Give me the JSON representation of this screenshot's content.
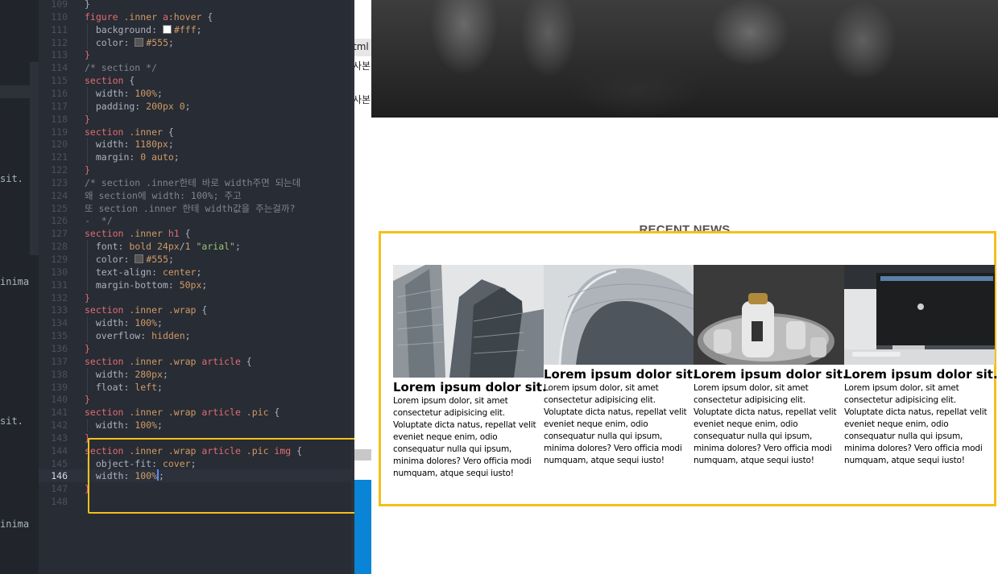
{
  "left_panel": {
    "fragments": [
      "sit.",
      "inima",
      "sit.",
      "inima"
    ]
  },
  "editor": {
    "lines": [
      {
        "n": "109",
        "t": [
          [
            "pun",
            "}"
          ]
        ]
      },
      {
        "n": "110",
        "t": [
          [
            "sel",
            "figure "
          ],
          [
            "cls",
            ".inner "
          ],
          [
            "sel",
            "a"
          ],
          [
            "kw",
            ":hover"
          ],
          [
            "pun",
            " {"
          ]
        ]
      },
      {
        "n": "111",
        "g": 1,
        "t": [
          [
            "prop",
            "  background: "
          ],
          [
            "sw",
            "#ffffff"
          ],
          [
            "num",
            "#fff"
          ],
          [
            "pun",
            ";"
          ]
        ]
      },
      {
        "n": "112",
        "g": 1,
        "t": [
          [
            "prop",
            "  color: "
          ],
          [
            "sw",
            "#555555"
          ],
          [
            "num",
            "#555"
          ],
          [
            "pun",
            ";"
          ]
        ]
      },
      {
        "n": "113",
        "t": [
          [
            "sel",
            "}"
          ]
        ]
      },
      {
        "n": "114",
        "t": [
          [
            "com",
            "/* section */"
          ]
        ]
      },
      {
        "n": "115",
        "t": [
          [
            "sel",
            "section"
          ],
          [
            "pun",
            " {"
          ]
        ]
      },
      {
        "n": "116",
        "g": 1,
        "t": [
          [
            "prop",
            "  width: "
          ],
          [
            "num",
            "100%"
          ],
          [
            "pun",
            ";"
          ]
        ]
      },
      {
        "n": "117",
        "g": 1,
        "t": [
          [
            "prop",
            "  padding: "
          ],
          [
            "num",
            "200px 0"
          ],
          [
            "pun",
            ";"
          ]
        ]
      },
      {
        "n": "118",
        "t": [
          [
            "sel",
            "}"
          ]
        ]
      },
      {
        "n": "119",
        "t": [
          [
            "sel",
            "section "
          ],
          [
            "cls",
            ".inner"
          ],
          [
            "pun",
            " {"
          ]
        ]
      },
      {
        "n": "120",
        "g": 1,
        "t": [
          [
            "prop",
            "  width: "
          ],
          [
            "num",
            "1180px"
          ],
          [
            "pun",
            ";"
          ]
        ]
      },
      {
        "n": "121",
        "g": 1,
        "t": [
          [
            "prop",
            "  margin: "
          ],
          [
            "num",
            "0 auto"
          ],
          [
            "pun",
            ";"
          ]
        ]
      },
      {
        "n": "122",
        "t": [
          [
            "sel",
            "}"
          ]
        ]
      },
      {
        "n": "123",
        "t": [
          [
            "com",
            "/* section .inner한테 바로 width주면 되는데"
          ]
        ]
      },
      {
        "n": "124",
        "t": [
          [
            "com",
            "왜 section에 width: 100%; 주고"
          ]
        ]
      },
      {
        "n": "125",
        "t": [
          [
            "com",
            "또 section .inner 한테 width값을 주는걸까?"
          ]
        ]
      },
      {
        "n": "126",
        "t": [
          [
            "com",
            "-  */"
          ]
        ]
      },
      {
        "n": "127",
        "t": [
          [
            "sel",
            "section "
          ],
          [
            "cls",
            ".inner "
          ],
          [
            "sel",
            "h1"
          ],
          [
            "pun",
            " {"
          ]
        ]
      },
      {
        "n": "128",
        "g": 1,
        "t": [
          [
            "prop",
            "  font: "
          ],
          [
            "num",
            "bold 24px"
          ],
          [
            "pun",
            "/"
          ],
          [
            "num",
            "1 "
          ],
          [
            "str",
            "\"arial\""
          ],
          [
            "pun",
            ";"
          ]
        ]
      },
      {
        "n": "129",
        "g": 1,
        "t": [
          [
            "prop",
            "  color: "
          ],
          [
            "sw",
            "#555555"
          ],
          [
            "num",
            "#555"
          ],
          [
            "pun",
            ";"
          ]
        ]
      },
      {
        "n": "130",
        "g": 1,
        "t": [
          [
            "prop",
            "  text-align: "
          ],
          [
            "num",
            "center"
          ],
          [
            "pun",
            ";"
          ]
        ]
      },
      {
        "n": "131",
        "g": 1,
        "t": [
          [
            "prop",
            "  margin-bottom: "
          ],
          [
            "num",
            "50px"
          ],
          [
            "pun",
            ";"
          ]
        ]
      },
      {
        "n": "132",
        "t": [
          [
            "sel",
            "}"
          ]
        ]
      },
      {
        "n": "133",
        "t": [
          [
            "sel",
            "section "
          ],
          [
            "cls",
            ".inner .wrap"
          ],
          [
            "pun",
            " {"
          ]
        ]
      },
      {
        "n": "134",
        "g": 1,
        "t": [
          [
            "prop",
            "  width: "
          ],
          [
            "num",
            "100%"
          ],
          [
            "pun",
            ";"
          ]
        ]
      },
      {
        "n": "135",
        "g": 1,
        "t": [
          [
            "prop",
            "  overflow: "
          ],
          [
            "num",
            "hidden"
          ],
          [
            "pun",
            ";"
          ]
        ]
      },
      {
        "n": "136",
        "t": [
          [
            "sel",
            "}"
          ]
        ]
      },
      {
        "n": "137",
        "t": [
          [
            "sel",
            "section "
          ],
          [
            "cls",
            ".inner .wrap "
          ],
          [
            "sel",
            "article"
          ],
          [
            "pun",
            " {"
          ]
        ]
      },
      {
        "n": "138",
        "g": 1,
        "t": [
          [
            "prop",
            "  width: "
          ],
          [
            "num",
            "280px"
          ],
          [
            "pun",
            ";"
          ]
        ]
      },
      {
        "n": "139",
        "g": 1,
        "t": [
          [
            "prop",
            "  float: "
          ],
          [
            "num",
            "left"
          ],
          [
            "pun",
            ";"
          ]
        ]
      },
      {
        "n": "140",
        "t": [
          [
            "sel",
            "}"
          ]
        ]
      },
      {
        "n": "141",
        "t": [
          [
            "sel",
            "section "
          ],
          [
            "cls",
            ".inner .wrap "
          ],
          [
            "sel",
            "article "
          ],
          [
            "cls",
            ".pic"
          ],
          [
            "pun",
            " {"
          ]
        ]
      },
      {
        "n": "142",
        "g": 1,
        "t": [
          [
            "prop",
            "  width: "
          ],
          [
            "num",
            "100%"
          ],
          [
            "pun",
            ";"
          ]
        ]
      },
      {
        "n": "143",
        "t": [
          [
            "sel",
            "}"
          ]
        ]
      },
      {
        "n": "144",
        "t": [
          [
            "sel",
            "section "
          ],
          [
            "cls",
            ".inner .wrap "
          ],
          [
            "sel",
            "article "
          ],
          [
            "cls",
            ".pic "
          ],
          [
            "sel",
            "img"
          ],
          [
            "pun",
            " {"
          ]
        ]
      },
      {
        "n": "145",
        "g": 1,
        "t": [
          [
            "prop",
            "  object-fit: "
          ],
          [
            "num",
            "cover"
          ],
          [
            "pun",
            ";"
          ]
        ]
      },
      {
        "n": "146",
        "g": 1,
        "a": 1,
        "t": [
          [
            "prop",
            "  width: "
          ],
          [
            "num",
            "100%"
          ],
          [
            "cur",
            ""
          ],
          [
            "pun",
            ";"
          ]
        ]
      },
      {
        "n": "147",
        "t": [
          [
            "sel",
            "}"
          ]
        ]
      },
      {
        "n": "148",
        "t": []
      }
    ]
  },
  "mid_strip": {
    "fragments": [
      "tml",
      "사본",
      "사본"
    ]
  },
  "preview": {
    "section_title": "RECENT NEWS",
    "articles": [
      {
        "title": "Lorem ipsum dolor sit.",
        "body": "Lorem ipsum dolor, sit amet consectetur adipisicing elit. Voluptate dicta natus, repellat velit eveniet neque enim, odio consequatur nulla qui ipsum, minima dolores? Vero officia modi numquam, atque sequi iusto!",
        "image": "skyscrapers"
      },
      {
        "title": "Lorem ipsum dolor sit.",
        "body": "Lorem ipsum dolor, sit amet consectetur adipisicing elit. Voluptate dicta natus, repellat velit eveniet neque enim, odio consequatur nulla qui ipsum, minima dolores? Vero officia modi numquam, atque sequi iusto!",
        "image": "curved-building"
      },
      {
        "title": "Lorem ipsum dolor sit.",
        "body": "Lorem ipsum dolor, sit amet consectetur adipisicing elit. Voluptate dicta natus, repellat velit eveniet neque enim, odio consequatur nulla qui ipsum, minima dolores? Vero officia modi numquam, atque sequi iusto!",
        "image": "bottles-in-ice"
      },
      {
        "title": "Lorem ipsum dolor sit.",
        "body": "Lorem ipsum dolor, sit amet consectetur adipisicing elit. Voluptate dicta natus, repellat velit eveniet neque enim, odio consequatur nulla qui ipsum, minima dolores? Vero officia modi numquam, atque sequi iusto!",
        "image": "imac-desk"
      }
    ]
  },
  "colors": {
    "highlight": "#f4bf1a",
    "editor_bg": "#282c34"
  }
}
